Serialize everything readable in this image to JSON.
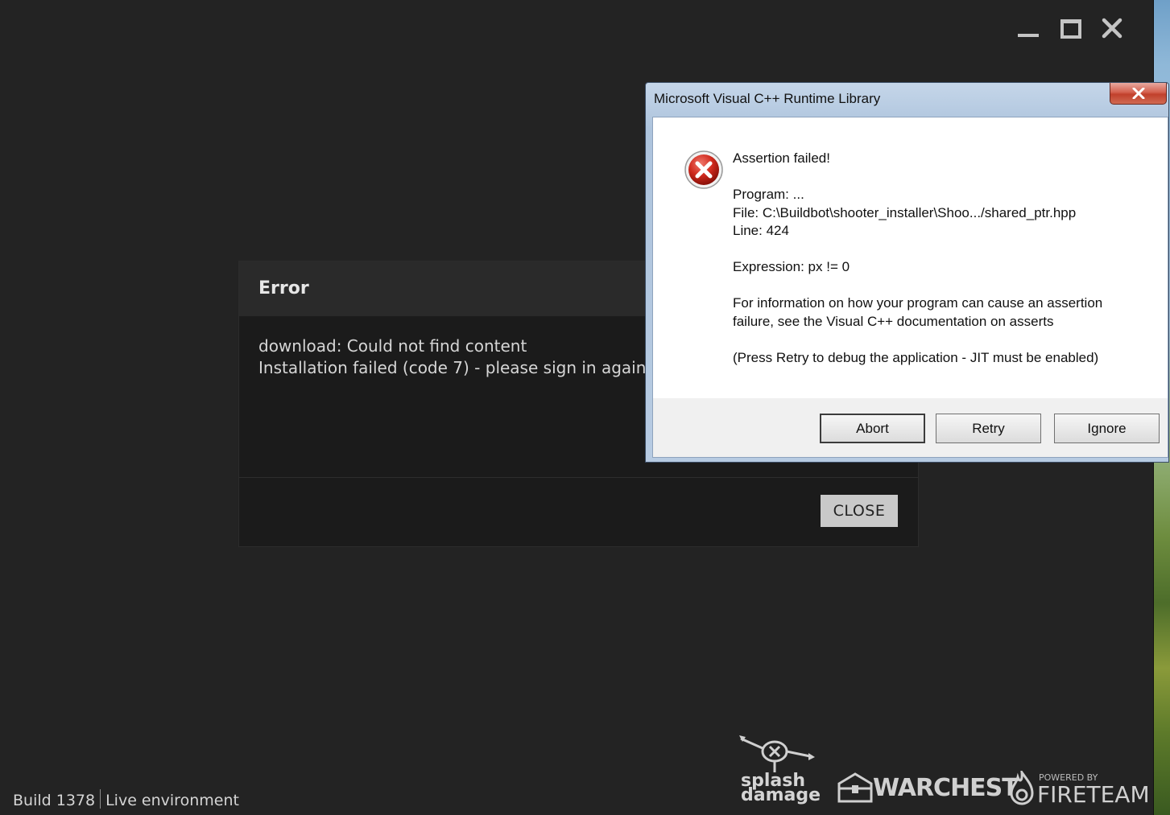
{
  "launcher": {
    "window_controls": [
      "minimize",
      "maximize",
      "close"
    ],
    "error_dialog": {
      "title": "Error",
      "message_line1": "download: Could not find content",
      "message_line2": "Installation failed (code 7) - please sign in again.",
      "close_label": "CLOSE"
    },
    "status": {
      "build": "Build 1378",
      "environment": "Live environment"
    },
    "logos": {
      "splash_line1": "splash",
      "splash_line2": "damage",
      "warchest": "WARCHEST",
      "fireteam_powered": "POWERED BY",
      "fireteam": "FIRETEAM"
    }
  },
  "msgbox": {
    "title": "Microsoft Visual C++ Runtime Library",
    "icon": "error-x-icon",
    "lines": {
      "assertion": "Assertion failed!",
      "program": "Program: ...",
      "file": "File: C:\\Buildbot\\shooter_installer\\Shoo.../shared_ptr.hpp",
      "line": "Line: 424",
      "expression": "Expression: px != 0",
      "info1": "For information on how your program can cause an assertion",
      "info2": "failure, see the Visual C++ documentation on asserts",
      "retry_hint": "(Press Retry to debug the application - JIT must be enabled)"
    },
    "buttons": {
      "abort": "Abort",
      "retry": "Retry",
      "ignore": "Ignore"
    }
  }
}
